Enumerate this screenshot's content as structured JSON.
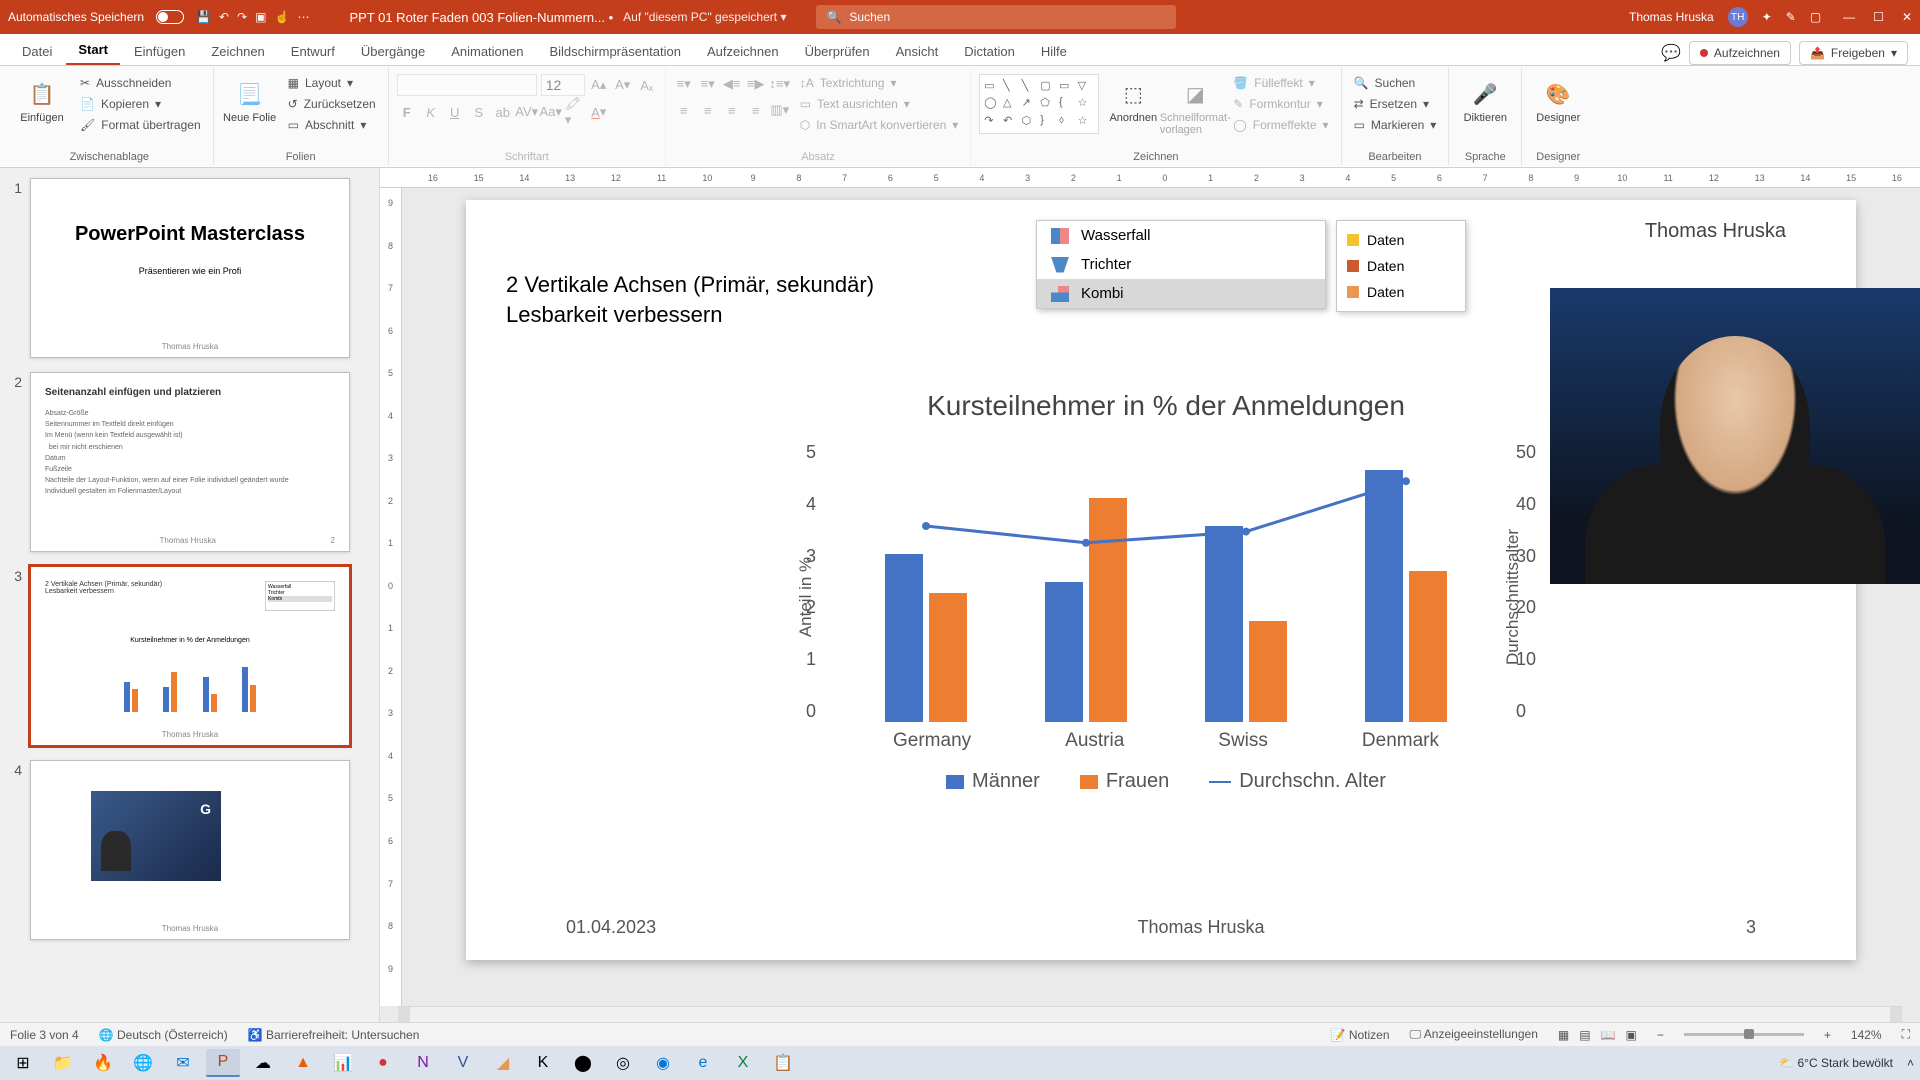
{
  "titlebar": {
    "autosave": "Automatisches Speichern",
    "doc_title": "PPT 01 Roter Faden 003 Folien-Nummern... •",
    "save_location": "Auf \"diesem PC\" gespeichert",
    "search_placeholder": "Suchen",
    "user_name": "Thomas Hruska",
    "user_initials": "TH"
  },
  "ribbon_tabs": [
    "Datei",
    "Start",
    "Einfügen",
    "Zeichnen",
    "Entwurf",
    "Übergänge",
    "Animationen",
    "Bildschirmpräsentation",
    "Aufzeichnen",
    "Überprüfen",
    "Ansicht",
    "Dictation",
    "Hilfe"
  ],
  "ribbon_active": 1,
  "ribbon_right": {
    "record": "Aufzeichnen",
    "share": "Freigeben"
  },
  "groups": {
    "clipboard": {
      "title": "Zwischenablage",
      "paste": "Einfügen",
      "cut": "Ausschneiden",
      "copy": "Kopieren",
      "format": "Format übertragen"
    },
    "slides": {
      "title": "Folien",
      "new": "Neue Folie",
      "layout": "Layout",
      "reset": "Zurücksetzen",
      "section": "Abschnitt"
    },
    "font": {
      "title": "Schriftart",
      "size": "12"
    },
    "paragraph": {
      "title": "Absatz",
      "dir": "Textrichtung",
      "align": "Text ausrichten",
      "smart": "In SmartArt konvertieren"
    },
    "drawing": {
      "title": "Zeichnen",
      "arrange": "Anordnen",
      "quick": "Schnellformat-vorlagen",
      "fill": "Fülleffekt",
      "outline": "Formkontur",
      "effects": "Formeffekte"
    },
    "editing": {
      "title": "Bearbeiten",
      "find": "Suchen",
      "replace": "Ersetzen",
      "select": "Markieren"
    },
    "voice": {
      "title": "Sprache",
      "dictate": "Diktieren"
    },
    "designer": {
      "title": "Designer",
      "label": "Designer"
    }
  },
  "thumbs": {
    "t1": {
      "title": "PowerPoint Masterclass",
      "sub": "Präsentieren wie ein Profi",
      "footer": "Thomas Hruska"
    },
    "t2": {
      "title": "Seitenanzahl einfügen und platzieren",
      "footer": "Thomas Hruska",
      "num": "2"
    },
    "t3": {
      "footer": "Thomas Hruska"
    },
    "t4": {
      "footer": "Thomas Hruska"
    }
  },
  "slide": {
    "author_top": "Thomas Hruska",
    "h1": "2 Vertikale Achsen (Primär, sekundär)",
    "h2": "Lesbarkeit verbessern",
    "footer_date": "01.04.2023",
    "footer_author": "Thomas Hruska",
    "footer_page": "3"
  },
  "charttype": {
    "wasserfall": "Wasserfall",
    "trichter": "Trichter",
    "kombi": "Kombi"
  },
  "legend_pop": {
    "d1": "Daten",
    "d2": "Daten",
    "d3": "Daten"
  },
  "chart_data": {
    "type": "combo",
    "title": "Kursteilnehmer in % der Anmeldungen",
    "categories": [
      "Germany",
      "Austria",
      "Swiss",
      "Denmark"
    ],
    "series": [
      {
        "name": "Männer",
        "type": "bar",
        "axis": "primary",
        "values": [
          3.0,
          2.5,
          3.5,
          4.5
        ]
      },
      {
        "name": "Frauen",
        "type": "bar",
        "axis": "primary",
        "values": [
          2.3,
          4.0,
          1.8,
          2.7
        ]
      },
      {
        "name": "Durchschn. Alter",
        "type": "line",
        "axis": "secondary",
        "values": [
          35,
          32,
          34,
          43
        ]
      }
    ],
    "ylabel_primary": "Anteil in %",
    "ylim_primary": [
      0,
      5
    ],
    "yticks_primary": [
      0,
      1,
      2,
      3,
      4,
      5
    ],
    "ylabel_secondary": "Durchschnittsalter",
    "ylim_secondary": [
      0,
      50
    ],
    "yticks_secondary": [
      0,
      10,
      20,
      30,
      40,
      50
    ],
    "colors": {
      "Männer": "#4472c4",
      "Frauen": "#ed7d31",
      "Durchschn. Alter": "#4472c4"
    }
  },
  "ruler_h": [
    "16",
    "15",
    "14",
    "13",
    "12",
    "11",
    "10",
    "9",
    "8",
    "7",
    "6",
    "5",
    "4",
    "3",
    "2",
    "1",
    "0",
    "1",
    "2",
    "3",
    "4",
    "5",
    "6",
    "7",
    "8",
    "9",
    "10",
    "11",
    "12",
    "13",
    "14",
    "15",
    "16"
  ],
  "ruler_v": [
    "9",
    "8",
    "7",
    "6",
    "5",
    "4",
    "3",
    "2",
    "1",
    "0",
    "1",
    "2",
    "3",
    "4",
    "5",
    "6",
    "7",
    "8",
    "9"
  ],
  "status": {
    "slide": "Folie 3 von 4",
    "lang": "Deutsch (Österreich)",
    "access": "Barrierefreiheit: Untersuchen",
    "notes": "Notizen",
    "display": "Anzeigeeinstellungen",
    "zoom": "142%"
  },
  "taskbar": {
    "weather_temp": "6°C",
    "weather_desc": "Stark bewölkt"
  }
}
